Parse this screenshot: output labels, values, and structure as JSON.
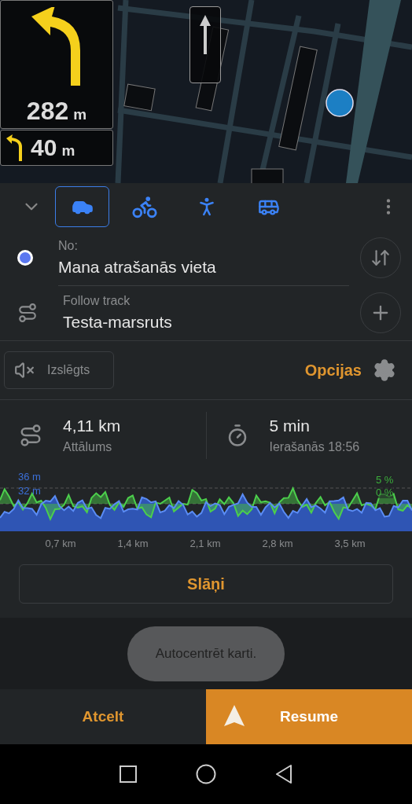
{
  "guidance": {
    "turn": {
      "distance": "282",
      "unit": "m"
    },
    "next_turn": {
      "distance": "40",
      "unit": "m"
    }
  },
  "modes": [
    {
      "kind": "car",
      "selected": true
    },
    {
      "kind": "bike",
      "selected": false
    },
    {
      "kind": "walk",
      "selected": false
    },
    {
      "kind": "bus",
      "selected": false
    }
  ],
  "points": [
    {
      "kind": "start",
      "label": "No:",
      "value": "Mana atrašanās vieta"
    },
    {
      "kind": "track",
      "label": "Follow track",
      "value": "Testa-marsruts"
    }
  ],
  "sound": {
    "label": "Izslēgts",
    "muted": true
  },
  "options": "Opcijas",
  "stats": [
    {
      "kind": "distance",
      "value": "4,11 km",
      "label": "Attālums"
    },
    {
      "kind": "time",
      "value": "5 min",
      "label": "Ierašanās 18:56"
    }
  ],
  "elevation": {
    "left_labels": [
      "36 m",
      "32 m"
    ],
    "right_labels": [
      "5 %",
      "0 %"
    ],
    "x_labels": [
      "0,7 km",
      "1,4 km",
      "2,1 km",
      "2,8 km",
      "3,5 km"
    ]
  },
  "layers_button": "Slāņi",
  "toast": "Autocentrēt karti.",
  "cancel_button": "Atcelt",
  "resume_button": "Resume"
}
